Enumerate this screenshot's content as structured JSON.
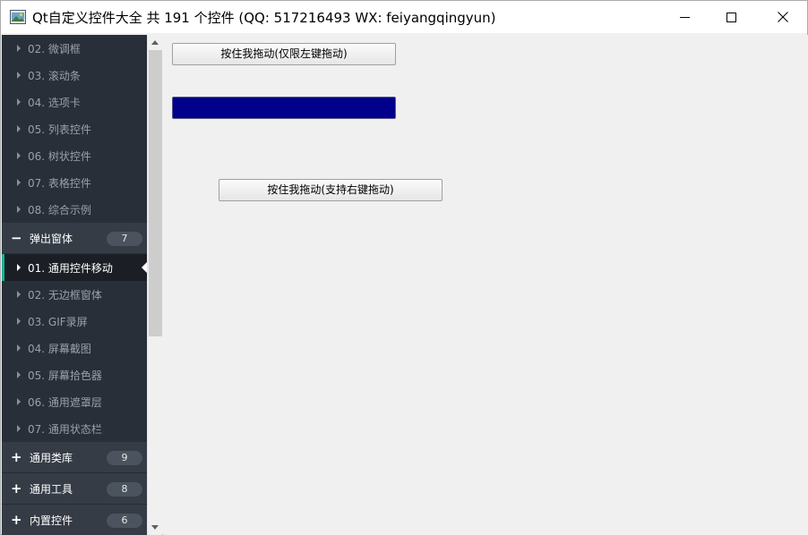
{
  "window": {
    "title": "Qt自定义控件大全 共 191 个控件 (QQ: 517216493 WX: feiyangqingyun)"
  },
  "sidebar": {
    "items_before": [
      {
        "label": "02. 微调框"
      },
      {
        "label": "03. 滚动条"
      },
      {
        "label": "04. 选项卡"
      },
      {
        "label": "05. 列表控件"
      },
      {
        "label": "06. 树状控件"
      },
      {
        "label": "07. 表格控件"
      },
      {
        "label": "08. 综合示例"
      }
    ],
    "expanded_group": {
      "label": "弹出窗体",
      "icon": "−",
      "count": "7"
    },
    "expanded_items": [
      {
        "label": "01. 通用控件移动",
        "active": true
      },
      {
        "label": "02. 无边框窗体"
      },
      {
        "label": "03. GIF录屏"
      },
      {
        "label": "04. 屏幕截图"
      },
      {
        "label": "05. 屏幕拾色器"
      },
      {
        "label": "06. 通用遮罩层"
      },
      {
        "label": "07. 通用状态栏"
      }
    ],
    "collapsed_groups": [
      {
        "label": "通用类库",
        "icon": "+",
        "count": "9"
      },
      {
        "label": "通用工具",
        "icon": "+",
        "count": "8"
      },
      {
        "label": "内置控件",
        "icon": "+",
        "count": "6"
      }
    ]
  },
  "content": {
    "button_left_drag": "按住我拖动(仅限左键拖动)",
    "button_right_drag": "按住我拖动(支持右键拖动)"
  },
  "colors": {
    "sidebar_bg": "#292f38",
    "group_bg": "#353c46",
    "active_accent": "#19b394",
    "progress_fill": "#00008b"
  }
}
